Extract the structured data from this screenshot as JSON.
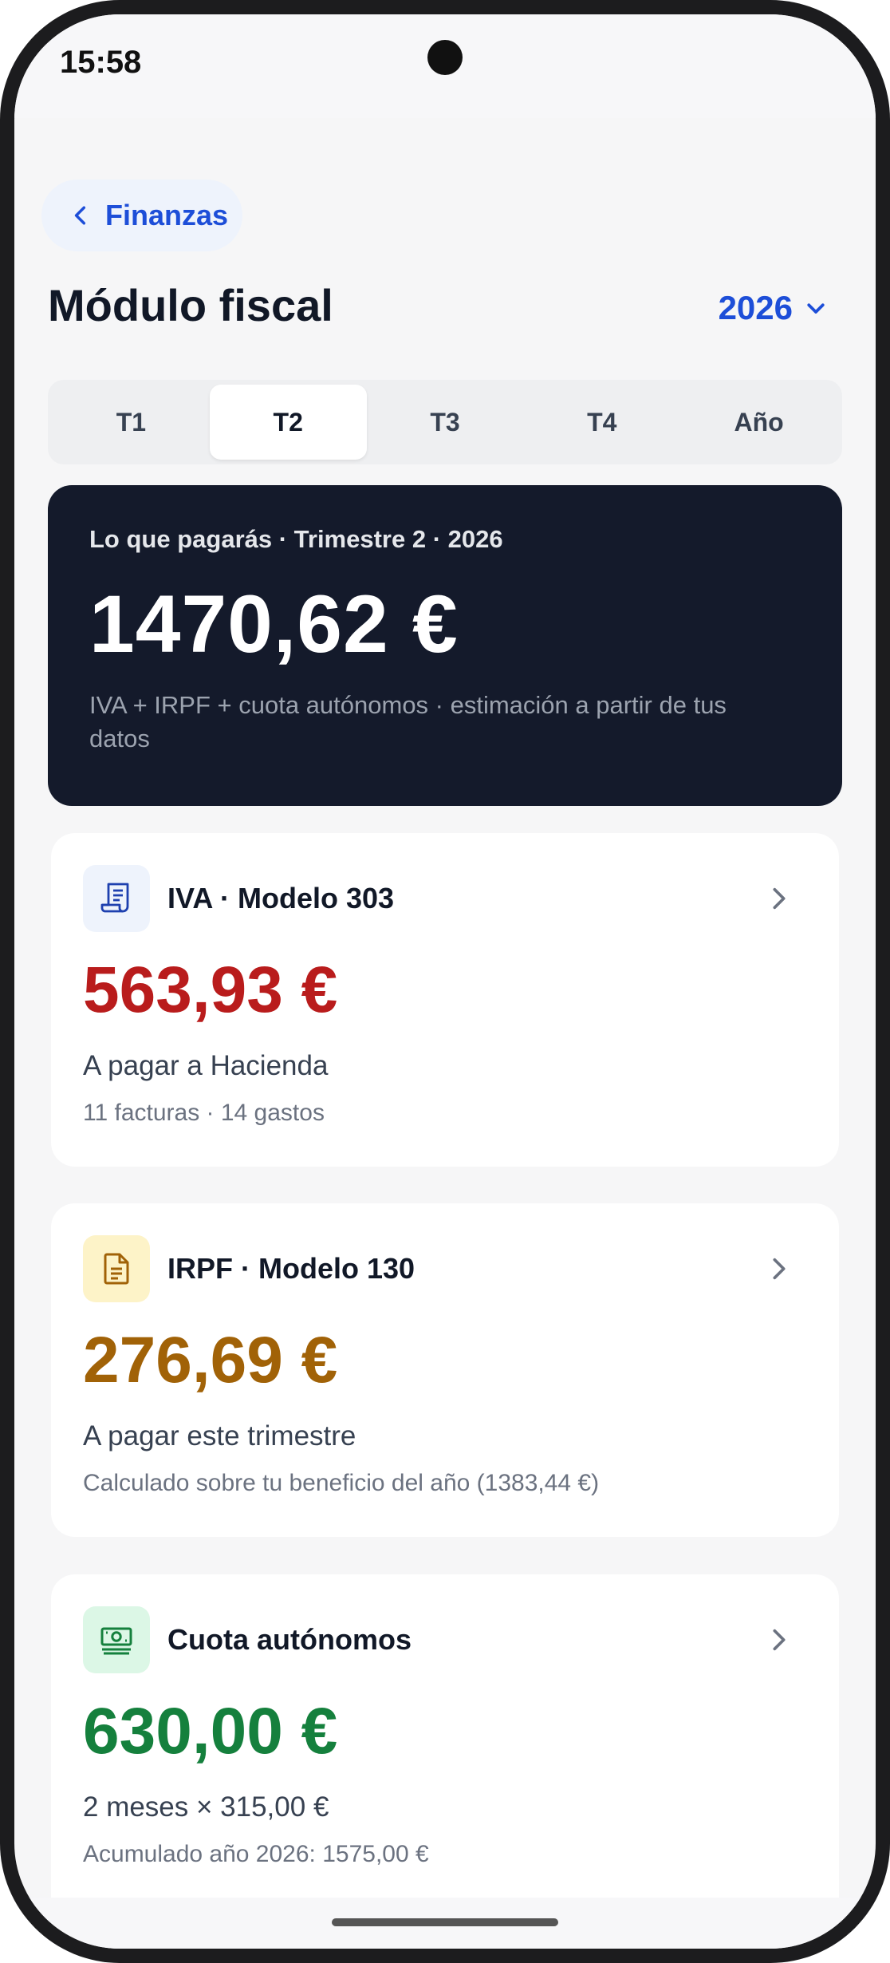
{
  "status": {
    "time": "15:58"
  },
  "nav": {
    "back_label": "Finanzas"
  },
  "header": {
    "title": "Módulo fiscal",
    "year": "2026"
  },
  "tabs": [
    {
      "label": "T1",
      "active": false
    },
    {
      "label": "T2",
      "active": true
    },
    {
      "label": "T3",
      "active": false
    },
    {
      "label": "T4",
      "active": false
    },
    {
      "label": "Año",
      "active": false
    }
  ],
  "summary": {
    "label": "Lo que pagarás · Trimestre 2 · 2026",
    "amount": "1470,62 €",
    "note": "IVA + IRPF + cuota autónomos · estimación a partir de tus datos"
  },
  "cards": [
    {
      "title": "IVA · Modelo 303",
      "icon": "receipt-icon",
      "amount": "563,93 €",
      "amount_color": "#b91c1c",
      "subtitle": "A pagar a Hacienda",
      "meta": "11 facturas · 14 gastos"
    },
    {
      "title": "IRPF · Modelo 130",
      "icon": "document-icon",
      "amount": "276,69 €",
      "amount_color": "#a16207",
      "subtitle": "A pagar este trimestre",
      "meta": "Calculado sobre tu beneficio del año (1383,44 €)"
    },
    {
      "title": "Cuota autónomos",
      "icon": "banknote-icon",
      "amount": "630,00 €",
      "amount_color": "#15803d",
      "subtitle": "2 meses × 315,00 €",
      "meta": "Acumulado año 2026: 1575,00 €"
    }
  ]
}
